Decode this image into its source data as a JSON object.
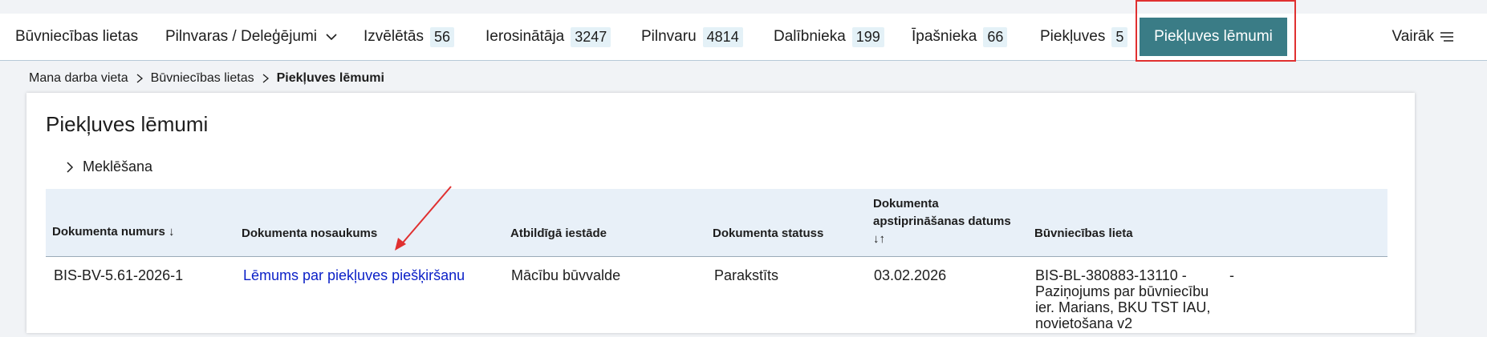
{
  "nav": {
    "tabs": [
      {
        "label": "Būvniecības lietas"
      },
      {
        "label": "Pilnvaras / Deleģējumi"
      },
      {
        "label": "Izvēlētās",
        "count": "56"
      },
      {
        "label": "Ierosinātāja",
        "count": "3247"
      },
      {
        "label": "Pilnvaru",
        "count": "4814"
      },
      {
        "label": "Dalībnieka",
        "count": "199"
      },
      {
        "label": "Īpašnieka",
        "count": "66"
      },
      {
        "label": "Piekļuves",
        "count": "5"
      }
    ],
    "active_tab": "Piekļuves lēmumi",
    "more": "Vairāk"
  },
  "breadcrumb": {
    "items": [
      "Mana darba vieta",
      "Būvniecības lietas"
    ],
    "current": "Piekļuves lēmumi"
  },
  "page": {
    "title": "Piekļuves lēmumi",
    "search_label": "Meklēšana"
  },
  "table": {
    "headers": {
      "number": "Dokumenta numurs ↓",
      "name": "Dokumenta nosaukums",
      "authority": "Atbildīgā iestāde",
      "status": "Dokumenta statuss",
      "date_line1": "Dokumenta",
      "date_line2": "apstiprināšanas datums",
      "date_sort": "↓↑",
      "case": "Būvniecības lieta"
    },
    "rows": [
      {
        "number": "BIS-BV-5.61-2026-1",
        "name": "Lēmums par piekļuves piešķiršanu",
        "authority": "Mācību būvvalde",
        "status": "Parakstīts",
        "date": "03.02.2026",
        "case_1": "BIS-BL-380883-13110 -",
        "case_2": "Paziņojums par būvniecību",
        "case_3": "ier. Marians, BKU TST IAU,",
        "case_4": "novietošana v2",
        "extra": "-"
      }
    ]
  },
  "colors": {
    "active_tab_bg": "#3a7c86",
    "highlight_frame": "#e03030",
    "link": "#0a1fc7",
    "badge_bg": "#e4f1f7"
  }
}
